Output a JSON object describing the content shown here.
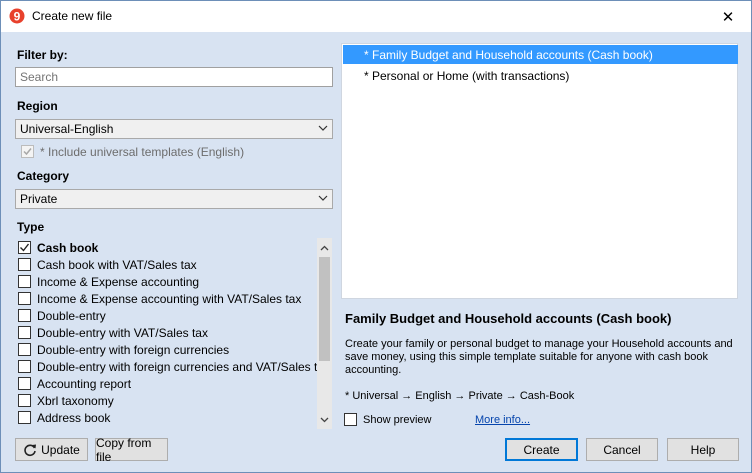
{
  "window": {
    "title": "Create new file",
    "close_glyph": "✕"
  },
  "filter": {
    "label": "Filter by:",
    "search_placeholder": "Search"
  },
  "region": {
    "label": "Region",
    "selected": "Universal-English",
    "include_universal_label": "* Include universal templates (English)",
    "include_universal_checked": true
  },
  "category": {
    "label": "Category",
    "selected": "Private"
  },
  "type": {
    "label": "Type",
    "items": [
      {
        "label": "Cash book",
        "checked": true
      },
      {
        "label": "Cash book with VAT/Sales tax",
        "checked": false
      },
      {
        "label": "Income & Expense accounting",
        "checked": false
      },
      {
        "label": "Income & Expense accounting with VAT/Sales tax",
        "checked": false
      },
      {
        "label": "Double-entry",
        "checked": false
      },
      {
        "label": "Double-entry with VAT/Sales tax",
        "checked": false
      },
      {
        "label": "Double-entry with foreign currencies",
        "checked": false
      },
      {
        "label": "Double-entry with foreign currencies and VAT/Sales tax",
        "checked": false
      },
      {
        "label": "Accounting report",
        "checked": false
      },
      {
        "label": "Xbrl taxonomy",
        "checked": false
      },
      {
        "label": "Address book",
        "checked": false
      }
    ]
  },
  "buttons": {
    "update": "Update",
    "copy_from_file": "Copy from file",
    "create": "Create",
    "cancel": "Cancel",
    "help": "Help"
  },
  "templates": {
    "items": [
      {
        "label": "* Family Budget and Household accounts (Cash book)",
        "selected": true
      },
      {
        "label": "* Personal or Home  (with transactions)",
        "selected": false
      }
    ]
  },
  "detail": {
    "title": "Family Budget and Household accounts (Cash book)",
    "description": "Create your family or personal budget to manage your Household accounts and save money, using this simple template suitable for anyone with cash book accounting.",
    "path": "* Universal → English → Private → Cash-Book",
    "show_preview_label": "Show preview",
    "show_preview_checked": false,
    "more_info_label": "More info..."
  },
  "colors": {
    "dialog_bg": "#d8e3f2",
    "selection": "#3399ff",
    "link": "#0645ad",
    "app_icon": "#e8412c"
  },
  "icons": {
    "app": "banana-logo-icon",
    "update": "refresh-icon"
  }
}
